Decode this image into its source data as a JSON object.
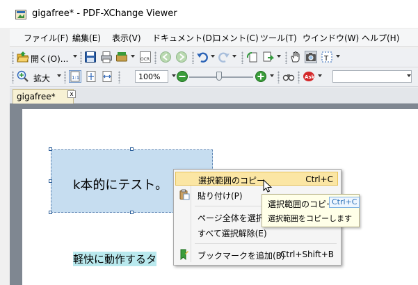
{
  "window": {
    "title": "gigafree* - PDF-XChange Viewer"
  },
  "menubar": {
    "items": [
      "ファイル(F)",
      "編集(E)",
      "表示(V)",
      "ドキュメント(D)",
      "コメント(C)",
      "ツール(T)",
      "ウインドウ(W)",
      "ヘルプ(H)"
    ]
  },
  "toolbar1": {
    "open_label": "開く(O)..."
  },
  "toolbar2": {
    "zoom_label": "拡大",
    "zoom_value": "100%"
  },
  "tab": {
    "label": "gigafree*",
    "close": "x"
  },
  "document": {
    "box_text": "k本的にテスト。",
    "bottom_text": "軽快に動作するタ"
  },
  "context_menu": {
    "items": [
      {
        "label": "選択範囲のコピー",
        "shortcut": "Ctrl+C",
        "highlighted": true
      },
      {
        "label": "貼り付け(P)",
        "shortcut": ""
      },
      {
        "label": "ページ全体を選択",
        "shortcut": ""
      },
      {
        "label": "すべて選択解除(E)",
        "shortcut": ""
      },
      {
        "label": "ブックマークを追加(B)",
        "shortcut": "Ctrl+Shift+B"
      }
    ]
  },
  "tooltip": {
    "title": "選択範囲のコピー",
    "shortcut": "Ctrl+C",
    "description": "選択範囲をコピーします"
  },
  "colors": {
    "selection_fill": "#c6ddf0",
    "highlight": "#fbe6a4",
    "doc_background": "#7f8791"
  }
}
